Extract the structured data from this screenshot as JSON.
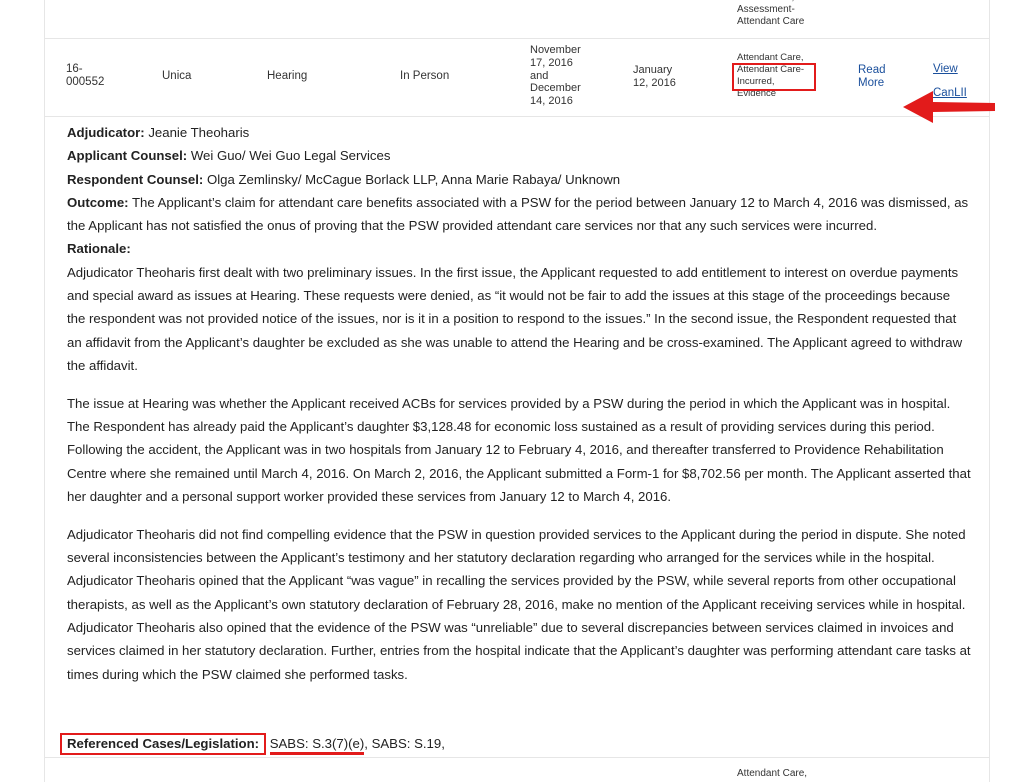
{
  "top_row": {
    "issues_fragment": "Assessment,\nAssessment-\nAttendant Care"
  },
  "case_row": {
    "file_number": "16-\n000552",
    "insurer": "Unica",
    "decision_type": "Hearing",
    "format": "In Person",
    "hearing_dates": "November\n17, 2016\nand\nDecember\n14, 2016",
    "accident_date": "January\n12, 2016",
    "issues": [
      "Attendant Care,",
      "Attendant Care-",
      "Incurred,",
      "Evidence"
    ],
    "read_more": "Read\nMore",
    "view_canlii": "View\nCanLII"
  },
  "summary": {
    "adjudicator_label": "Adjudicator:",
    "adjudicator": " Jeanie Theoharis",
    "applicant_counsel_label": "Applicant Counsel:",
    "applicant_counsel": " Wei Guo/ Wei Guo Legal Services",
    "respondent_counsel_label": "Respondent Counsel:",
    "respondent_counsel": " Olga Zemlinsky/ McCague Borlack LLP, Anna Marie Rabaya/ Unknown",
    "outcome_label": "Outcome:",
    "outcome": " The Applicant’s claim for attendant care benefits associated with a PSW for the period between January 12 to March 4, 2016 was dismissed, as the Applicant has not satisfied the onus of proving that the PSW provided attendant care services nor that any such services were incurred.",
    "rationale_label": "Rationale:",
    "para1": "Adjudicator Theoharis first dealt with two preliminary issues. In the first issue, the Applicant requested to add entitlement to interest on overdue payments and special award as issues at Hearing. These requests were denied, as “it would not be fair to add the issues at this stage of the proceedings because the respondent was not provided notice of the issues, nor is it in a position to respond to the issues.” In the second issue, the Respondent requested that an affidavit from the Applicant’s daughter be excluded as she was unable to attend the Hearing and be cross-examined. The Applicant agreed to withdraw the affidavit.",
    "para2": "The issue at Hearing was whether the Applicant received ACBs for services provided by a PSW during the period in which the Applicant was in hospital. The Respondent has already paid the Applicant’s daughter $3,128.48 for economic loss sustained as a result of providing services during this period. Following the accident, the Applicant was in two hospitals from January 12 to February 4, 2016, and thereafter transferred to Providence Rehabilitation Centre where she remained until March 4, 2016. On March 2, 2016, the Applicant submitted a Form-1 for $8,702.56 per month. The Applicant asserted that her daughter and a personal support worker provided these services from January 12 to March 4, 2016.",
    "para3": "Adjudicator Theoharis did not find compelling evidence that the PSW in question provided services to the Applicant during the period in dispute. She noted several inconsistencies between the Applicant’s testimony and her statutory declaration regarding who arranged for the services while in the hospital. Adjudicator Theoharis opined that the Applicant “was vague” in recalling the services provided by the PSW, while several reports from other occupational therapists, as well as the Applicant’s own statutory declaration of February 28, 2016, make no mention of the Applicant receiving services while in hospital. Adjudicator Theoharis also opined that the evidence of the PSW was “unreliable” due to several discrepancies between services claimed in invoices and services claimed in her statutory declaration. Further, entries from the hospital indicate that the Applicant’s daughter was performing attendant care tasks at times during which the PSW claimed she performed tasks.",
    "referenced_label": "Referenced Cases/Legislation:",
    "ref_1": "SABS: S.3(7)(e)",
    "ref_sep": ", ",
    "ref_2": "SABS: S.19,"
  },
  "bottom_row": {
    "issues_fragment": "Attendant Care,"
  },
  "colors": {
    "highlight": "#e21b1b",
    "link": "#1a4f9c",
    "border": "#e6e6e6"
  },
  "icons": {
    "annotation_arrow": "arrow-left-icon"
  }
}
